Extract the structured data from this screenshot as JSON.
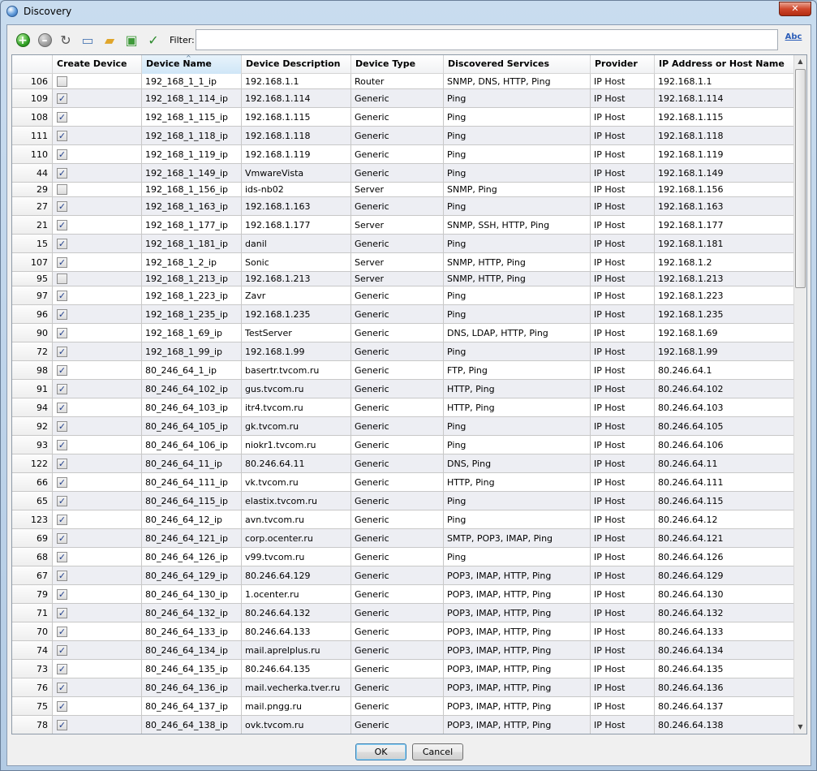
{
  "window": {
    "title": "Discovery",
    "close_label": "✕"
  },
  "toolbar": {
    "add_label": "+",
    "remove_label": "–",
    "refresh_label": "↻",
    "properties_label": "▭",
    "open_label": "▰",
    "save_label": "▣",
    "check_label": "✓",
    "filter_label": "Filter:",
    "filter_value": "",
    "spell_label": "Abc"
  },
  "table": {
    "columns": [
      "",
      "Create Device",
      "Device Name",
      "Device Description",
      "Device Type",
      "Discovered Services",
      "Provider",
      "IP Address or Host Name"
    ],
    "sort_indicator": "^",
    "rows": [
      {
        "id": "106",
        "create": false,
        "name": "192_168_1_1_ip",
        "desc": "192.168.1.1",
        "type": "Router",
        "services": "SNMP, DNS, HTTP, Ping",
        "provider": "IP Host",
        "ip": "192.168.1.1",
        "h": 19
      },
      {
        "id": "109",
        "create": true,
        "name": "192_168_1_114_ip",
        "desc": "192.168.1.114",
        "type": "Generic",
        "services": "Ping",
        "provider": "IP Host",
        "ip": "192.168.1.114",
        "h": 23
      },
      {
        "id": "108",
        "create": true,
        "name": "192_168_1_115_ip",
        "desc": "192.168.1.115",
        "type": "Generic",
        "services": "Ping",
        "provider": "IP Host",
        "ip": "192.168.1.115",
        "h": 23
      },
      {
        "id": "111",
        "create": true,
        "name": "192_168_1_118_ip",
        "desc": "192.168.1.118",
        "type": "Generic",
        "services": "Ping",
        "provider": "IP Host",
        "ip": "192.168.1.118",
        "h": 23
      },
      {
        "id": "110",
        "create": true,
        "name": "192_168_1_119_ip",
        "desc": "192.168.1.119",
        "type": "Generic",
        "services": "Ping",
        "provider": "IP Host",
        "ip": "192.168.1.119",
        "h": 23
      },
      {
        "id": "44",
        "create": true,
        "name": "192_168_1_149_ip",
        "desc": "VmwareVista",
        "type": "Generic",
        "services": "Ping",
        "provider": "IP Host",
        "ip": "192.168.1.149",
        "h": 23
      },
      {
        "id": "29",
        "create": false,
        "name": "192_168_1_156_ip",
        "desc": "ids-nb02",
        "type": "Server",
        "services": "SNMP, Ping",
        "provider": "IP Host",
        "ip": "192.168.1.156",
        "h": 18
      },
      {
        "id": "27",
        "create": true,
        "name": "192_168_1_163_ip",
        "desc": "192.168.1.163",
        "type": "Generic",
        "services": "Ping",
        "provider": "IP Host",
        "ip": "192.168.1.163",
        "h": 23
      },
      {
        "id": "21",
        "create": true,
        "name": "192_168_1_177_ip",
        "desc": "192.168.1.177",
        "type": "Server",
        "services": "SNMP, SSH, HTTP, Ping",
        "provider": "IP Host",
        "ip": "192.168.1.177",
        "h": 23
      },
      {
        "id": "15",
        "create": true,
        "name": "192_168_1_181_ip",
        "desc": "danil",
        "type": "Generic",
        "services": "Ping",
        "provider": "IP Host",
        "ip": "192.168.1.181",
        "h": 23
      },
      {
        "id": "107",
        "create": true,
        "name": "192_168_1_2_ip",
        "desc": "Sonic",
        "type": "Server",
        "services": "SNMP, HTTP, Ping",
        "provider": "IP Host",
        "ip": "192.168.1.2",
        "h": 23
      },
      {
        "id": "95",
        "create": false,
        "name": "192_168_1_213_ip",
        "desc": "192.168.1.213",
        "type": "Server",
        "services": "SNMP, HTTP, Ping",
        "provider": "IP Host",
        "ip": "192.168.1.213",
        "h": 18
      },
      {
        "id": "97",
        "create": true,
        "name": "192_168_1_223_ip",
        "desc": "Zavr",
        "type": "Generic",
        "services": "Ping",
        "provider": "IP Host",
        "ip": "192.168.1.223",
        "h": 23
      },
      {
        "id": "96",
        "create": true,
        "name": "192_168_1_235_ip",
        "desc": "192.168.1.235",
        "type": "Generic",
        "services": "Ping",
        "provider": "IP Host",
        "ip": "192.168.1.235",
        "h": 23
      },
      {
        "id": "90",
        "create": true,
        "name": "192_168_1_69_ip",
        "desc": "TestServer",
        "type": "Generic",
        "services": "DNS, LDAP, HTTP, Ping",
        "provider": "IP Host",
        "ip": "192.168.1.69",
        "h": 23
      },
      {
        "id": "72",
        "create": true,
        "name": "192_168_1_99_ip",
        "desc": "192.168.1.99",
        "type": "Generic",
        "services": "Ping",
        "provider": "IP Host",
        "ip": "192.168.1.99",
        "h": 23
      },
      {
        "id": "98",
        "create": true,
        "name": "80_246_64_1_ip",
        "desc": "basertr.tvcom.ru",
        "type": "Generic",
        "services": "FTP, Ping",
        "provider": "IP Host",
        "ip": "80.246.64.1",
        "h": 23
      },
      {
        "id": "91",
        "create": true,
        "name": "80_246_64_102_ip",
        "desc": "gus.tvcom.ru",
        "type": "Generic",
        "services": "HTTP, Ping",
        "provider": "IP Host",
        "ip": "80.246.64.102",
        "h": 23
      },
      {
        "id": "94",
        "create": true,
        "name": "80_246_64_103_ip",
        "desc": "itr4.tvcom.ru",
        "type": "Generic",
        "services": "HTTP, Ping",
        "provider": "IP Host",
        "ip": "80.246.64.103",
        "h": 23
      },
      {
        "id": "92",
        "create": true,
        "name": "80_246_64_105_ip",
        "desc": "gk.tvcom.ru",
        "type": "Generic",
        "services": "Ping",
        "provider": "IP Host",
        "ip": "80.246.64.105",
        "h": 23
      },
      {
        "id": "93",
        "create": true,
        "name": "80_246_64_106_ip",
        "desc": "niokr1.tvcom.ru",
        "type": "Generic",
        "services": "Ping",
        "provider": "IP Host",
        "ip": "80.246.64.106",
        "h": 23
      },
      {
        "id": "122",
        "create": true,
        "name": "80_246_64_11_ip",
        "desc": "80.246.64.11",
        "type": "Generic",
        "services": "DNS, Ping",
        "provider": "IP Host",
        "ip": "80.246.64.11",
        "h": 23
      },
      {
        "id": "66",
        "create": true,
        "name": "80_246_64_111_ip",
        "desc": "vk.tvcom.ru",
        "type": "Generic",
        "services": "HTTP, Ping",
        "provider": "IP Host",
        "ip": "80.246.64.111",
        "h": 23
      },
      {
        "id": "65",
        "create": true,
        "name": "80_246_64_115_ip",
        "desc": "elastix.tvcom.ru",
        "type": "Generic",
        "services": "Ping",
        "provider": "IP Host",
        "ip": "80.246.64.115",
        "h": 23
      },
      {
        "id": "123",
        "create": true,
        "name": "80_246_64_12_ip",
        "desc": "avn.tvcom.ru",
        "type": "Generic",
        "services": "Ping",
        "provider": "IP Host",
        "ip": "80.246.64.12",
        "h": 23
      },
      {
        "id": "69",
        "create": true,
        "name": "80_246_64_121_ip",
        "desc": "corp.ocenter.ru",
        "type": "Generic",
        "services": "SMTP, POP3, IMAP, Ping",
        "provider": "IP Host",
        "ip": "80.246.64.121",
        "h": 23
      },
      {
        "id": "68",
        "create": true,
        "name": "80_246_64_126_ip",
        "desc": "v99.tvcom.ru",
        "type": "Generic",
        "services": "Ping",
        "provider": "IP Host",
        "ip": "80.246.64.126",
        "h": 23
      },
      {
        "id": "67",
        "create": true,
        "name": "80_246_64_129_ip",
        "desc": "80.246.64.129",
        "type": "Generic",
        "services": "POP3, IMAP, HTTP, Ping",
        "provider": "IP Host",
        "ip": "80.246.64.129",
        "h": 23
      },
      {
        "id": "79",
        "create": true,
        "name": "80_246_64_130_ip",
        "desc": "1.ocenter.ru",
        "type": "Generic",
        "services": "POP3, IMAP, HTTP, Ping",
        "provider": "IP Host",
        "ip": "80.246.64.130",
        "h": 23
      },
      {
        "id": "71",
        "create": true,
        "name": "80_246_64_132_ip",
        "desc": "80.246.64.132",
        "type": "Generic",
        "services": "POP3, IMAP, HTTP, Ping",
        "provider": "IP Host",
        "ip": "80.246.64.132",
        "h": 23
      },
      {
        "id": "70",
        "create": true,
        "name": "80_246_64_133_ip",
        "desc": "80.246.64.133",
        "type": "Generic",
        "services": "POP3, IMAP, HTTP, Ping",
        "provider": "IP Host",
        "ip": "80.246.64.133",
        "h": 23
      },
      {
        "id": "74",
        "create": true,
        "name": "80_246_64_134_ip",
        "desc": "mail.aprelplus.ru",
        "type": "Generic",
        "services": "POP3, IMAP, HTTP, Ping",
        "provider": "IP Host",
        "ip": "80.246.64.134",
        "h": 23
      },
      {
        "id": "73",
        "create": true,
        "name": "80_246_64_135_ip",
        "desc": "80.246.64.135",
        "type": "Generic",
        "services": "POP3, IMAP, HTTP, Ping",
        "provider": "IP Host",
        "ip": "80.246.64.135",
        "h": 23
      },
      {
        "id": "76",
        "create": true,
        "name": "80_246_64_136_ip",
        "desc": "mail.vecherka.tver.ru",
        "type": "Generic",
        "services": "POP3, IMAP, HTTP, Ping",
        "provider": "IP Host",
        "ip": "80.246.64.136",
        "h": 23
      },
      {
        "id": "75",
        "create": true,
        "name": "80_246_64_137_ip",
        "desc": "mail.pngg.ru",
        "type": "Generic",
        "services": "POP3, IMAP, HTTP, Ping",
        "provider": "IP Host",
        "ip": "80.246.64.137",
        "h": 23
      },
      {
        "id": "78",
        "create": true,
        "name": "80_246_64_138_ip",
        "desc": "ovk.tvcom.ru",
        "type": "Generic",
        "services": "POP3, IMAP, HTTP, Ping",
        "provider": "IP Host",
        "ip": "80.246.64.138",
        "h": 23
      }
    ]
  },
  "scrollbar": {
    "up_label": "▲",
    "down_label": "▼"
  },
  "buttons": {
    "ok_label": "OK",
    "cancel_label": "Cancel"
  }
}
